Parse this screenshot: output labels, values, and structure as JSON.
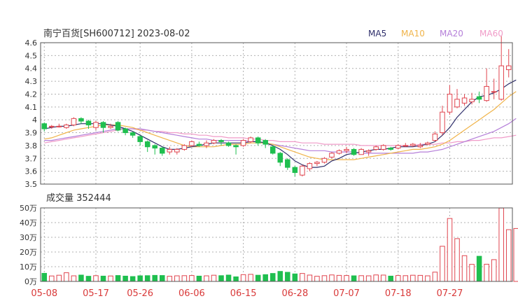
{
  "header": {
    "title": "南宁百货[SH600712] 2023-08-02",
    "legend": [
      {
        "label": "MA5",
        "color": "#2f2f6b"
      },
      {
        "label": "MA10",
        "color": "#f0b44a"
      },
      {
        "label": "MA20",
        "color": "#b57fd9"
      },
      {
        "label": "MA60",
        "color": "#f09bc8"
      }
    ]
  },
  "volume_panel": {
    "label": "成交量 352444"
  },
  "colors": {
    "up": "#e0454f",
    "down": "#1fbf4f",
    "grid": "#b0b0b0",
    "axis_text": "#333333",
    "x_text": "#d93a3a"
  },
  "chart_data": [
    {
      "type": "candlestick",
      "title": "南宁百货[SH600712] 2023-08-02",
      "ylim": [
        3.5,
        4.6
      ],
      "yticks": [
        "3.5",
        "3.6",
        "3.7",
        "3.8",
        "3.9",
        "4",
        "4.1",
        "4.2",
        "4.3",
        "4.4",
        "4.5",
        "4.6"
      ],
      "xticks": [
        {
          "index": 0,
          "label": "05-08"
        },
        {
          "index": 7,
          "label": "05-17"
        },
        {
          "index": 13,
          "label": "05-26"
        },
        {
          "index": 20,
          "label": "06-06"
        },
        {
          "index": 27,
          "label": "06-15"
        },
        {
          "index": 34,
          "label": "06-28"
        },
        {
          "index": 41,
          "label": "07-07"
        },
        {
          "index": 48,
          "label": "07-18"
        },
        {
          "index": 55,
          "label": "07-27"
        }
      ],
      "candles": [
        [
          3.97,
          3.93,
          3.98,
          3.91
        ],
        [
          3.95,
          3.95,
          3.96,
          3.93
        ],
        [
          3.95,
          3.95,
          3.97,
          3.94
        ],
        [
          3.94,
          3.96,
          3.97,
          3.93
        ],
        [
          3.96,
          4.01,
          4.02,
          3.95
        ],
        [
          4.01,
          3.99,
          4.02,
          3.97
        ],
        [
          3.99,
          3.96,
          4.0,
          3.93
        ],
        [
          3.94,
          3.98,
          3.99,
          3.92
        ],
        [
          3.98,
          3.94,
          3.99,
          3.9
        ],
        [
          3.94,
          3.95,
          3.97,
          3.93
        ],
        [
          3.98,
          3.92,
          3.99,
          3.91
        ],
        [
          3.93,
          3.9,
          3.94,
          3.88
        ],
        [
          3.9,
          3.88,
          3.91,
          3.86
        ],
        [
          3.87,
          3.83,
          3.88,
          3.8
        ],
        [
          3.83,
          3.79,
          3.84,
          3.75
        ],
        [
          3.8,
          3.78,
          3.81,
          3.73
        ],
        [
          3.78,
          3.74,
          3.79,
          3.72
        ],
        [
          3.75,
          3.77,
          3.79,
          3.73
        ],
        [
          3.75,
          3.77,
          3.78,
          3.73
        ],
        [
          3.77,
          3.8,
          3.81,
          3.76
        ],
        [
          3.8,
          3.83,
          3.84,
          3.79
        ],
        [
          3.81,
          3.8,
          3.83,
          3.79
        ],
        [
          3.8,
          3.82,
          3.84,
          3.78
        ],
        [
          3.82,
          3.84,
          3.85,
          3.81
        ],
        [
          3.84,
          3.83,
          3.85,
          3.8
        ],
        [
          3.82,
          3.8,
          3.83,
          3.79
        ],
        [
          3.8,
          3.79,
          3.81,
          3.73
        ],
        [
          3.8,
          3.84,
          3.85,
          3.79
        ],
        [
          3.83,
          3.86,
          3.87,
          3.82
        ],
        [
          3.86,
          3.82,
          3.87,
          3.8
        ],
        [
          3.84,
          3.81,
          3.85,
          3.78
        ],
        [
          3.79,
          3.74,
          3.8,
          3.73
        ],
        [
          3.74,
          3.67,
          3.75,
          3.64
        ],
        [
          3.69,
          3.63,
          3.7,
          3.61
        ],
        [
          3.63,
          3.59,
          3.64,
          3.56
        ],
        [
          3.57,
          3.64,
          3.65,
          3.56
        ],
        [
          3.62,
          3.66,
          3.67,
          3.6
        ],
        [
          3.66,
          3.67,
          3.68,
          3.64
        ],
        [
          3.67,
          3.7,
          3.71,
          3.66
        ],
        [
          3.71,
          3.74,
          3.75,
          3.7
        ],
        [
          3.74,
          3.76,
          3.77,
          3.73
        ],
        [
          3.76,
          3.77,
          3.79,
          3.74
        ],
        [
          3.77,
          3.73,
          3.78,
          3.72
        ],
        [
          3.73,
          3.77,
          3.78,
          3.73
        ],
        [
          3.75,
          3.76,
          3.77,
          3.72
        ],
        [
          3.77,
          3.79,
          3.8,
          3.76
        ],
        [
          3.77,
          3.8,
          3.81,
          3.76
        ],
        [
          3.78,
          3.77,
          3.79,
          3.76
        ],
        [
          3.78,
          3.8,
          3.81,
          3.77
        ],
        [
          3.8,
          3.8,
          3.82,
          3.79
        ],
        [
          3.8,
          3.81,
          3.82,
          3.79
        ],
        [
          3.79,
          3.8,
          3.82,
          3.78
        ],
        [
          3.81,
          3.82,
          3.83,
          3.8
        ],
        [
          3.84,
          3.89,
          3.91,
          3.83
        ],
        [
          3.9,
          4.06,
          4.11,
          3.88
        ],
        [
          4.06,
          4.2,
          4.27,
          4.04
        ],
        [
          4.1,
          4.16,
          4.24,
          4.09
        ],
        [
          4.13,
          4.17,
          4.2,
          4.11
        ],
        [
          4.14,
          4.16,
          4.21,
          4.12
        ],
        [
          4.18,
          4.16,
          4.22,
          4.13
        ],
        [
          4.15,
          4.26,
          4.4,
          4.14
        ],
        [
          4.22,
          4.22,
          4.32,
          4.16
        ],
        [
          4.16,
          4.42,
          4.65,
          4.15
        ],
        [
          4.39,
          4.42,
          4.55,
          4.33
        ]
      ],
      "ma": {
        "MA5": [
          3.93,
          3.94,
          3.95,
          3.95,
          3.96,
          3.97,
          3.97,
          3.97,
          3.97,
          3.96,
          3.95,
          3.93,
          3.91,
          3.88,
          3.85,
          3.82,
          3.79,
          3.77,
          3.77,
          3.78,
          3.79,
          3.8,
          3.81,
          3.82,
          3.82,
          3.82,
          3.82,
          3.82,
          3.83,
          3.83,
          3.82,
          3.8,
          3.77,
          3.73,
          3.68,
          3.65,
          3.63,
          3.63,
          3.64,
          3.68,
          3.7,
          3.73,
          3.74,
          3.75,
          3.76,
          3.77,
          3.77,
          3.78,
          3.79,
          3.79,
          3.79,
          3.8,
          3.81,
          3.83,
          3.88,
          3.94,
          4.02,
          4.08,
          4.14,
          4.18,
          4.19,
          4.21,
          4.24,
          4.28,
          4.31
        ],
        "MA10": [
          3.85,
          3.86,
          3.88,
          3.9,
          3.92,
          3.93,
          3.94,
          3.95,
          3.96,
          3.96,
          3.96,
          3.95,
          3.94,
          3.92,
          3.9,
          3.88,
          3.86,
          3.84,
          3.82,
          3.8,
          3.79,
          3.79,
          3.79,
          3.79,
          3.8,
          3.81,
          3.81,
          3.81,
          3.82,
          3.82,
          3.82,
          3.81,
          3.79,
          3.77,
          3.75,
          3.73,
          3.71,
          3.7,
          3.69,
          3.69,
          3.69,
          3.69,
          3.69,
          3.7,
          3.71,
          3.72,
          3.73,
          3.74,
          3.75,
          3.76,
          3.77,
          3.77,
          3.78,
          3.79,
          3.81,
          3.84,
          3.88,
          3.92,
          3.96,
          4.0,
          4.04,
          4.08,
          4.13,
          4.18,
          4.22
        ],
        "MA20": [
          3.84,
          3.84,
          3.85,
          3.86,
          3.87,
          3.88,
          3.89,
          3.9,
          3.91,
          3.92,
          3.93,
          3.93,
          3.93,
          3.93,
          3.92,
          3.91,
          3.9,
          3.89,
          3.88,
          3.87,
          3.86,
          3.85,
          3.85,
          3.84,
          3.84,
          3.84,
          3.84,
          3.84,
          3.83,
          3.83,
          3.82,
          3.81,
          3.8,
          3.79,
          3.78,
          3.77,
          3.76,
          3.76,
          3.76,
          3.75,
          3.75,
          3.75,
          3.75,
          3.74,
          3.74,
          3.74,
          3.74,
          3.74,
          3.74,
          3.74,
          3.74,
          3.75,
          3.75,
          3.76,
          3.77,
          3.79,
          3.81,
          3.83,
          3.85,
          3.87,
          3.89,
          3.91,
          3.94,
          3.97,
          4.01
        ],
        "MA60": [
          3.82,
          3.83,
          3.84,
          3.85,
          3.86,
          3.87,
          3.88,
          3.89,
          3.9,
          3.91,
          3.92,
          3.93,
          3.93,
          3.92,
          3.92,
          3.91,
          3.91,
          3.9,
          3.9,
          3.89,
          3.89,
          3.88,
          3.88,
          3.87,
          3.87,
          3.86,
          3.86,
          3.86,
          3.85,
          3.85,
          3.84,
          3.84,
          3.83,
          3.83,
          3.83,
          3.82,
          3.82,
          3.82,
          3.81,
          3.81,
          3.81,
          3.81,
          3.81,
          3.8,
          3.8,
          3.8,
          3.8,
          3.8,
          3.8,
          3.8,
          3.8,
          3.81,
          3.81,
          3.81,
          3.82,
          3.82,
          3.83,
          3.83,
          3.84,
          3.84,
          3.85,
          3.86,
          3.86,
          3.87,
          3.88
        ]
      }
    },
    {
      "type": "bar",
      "title": "成交量 352444",
      "ylim": [
        0,
        50
      ],
      "unit": "万",
      "yticks": [
        "0万",
        "10万",
        "20万",
        "30万",
        "40万",
        "50万"
      ],
      "values": [
        5.5,
        3.7,
        4.2,
        5.9,
        3.8,
        4.3,
        3.5,
        3.9,
        3.6,
        3.7,
        4.0,
        3.6,
        3.3,
        3.8,
        3.9,
        4.1,
        4.0,
        3.5,
        3.8,
        3.9,
        4.0,
        3.6,
        3.8,
        4.2,
        3.9,
        4.3,
        3.1,
        4.6,
        4.8,
        4.2,
        4.6,
        5.4,
        6.8,
        6.2,
        5.1,
        5.4,
        4.3,
        3.5,
        3.9,
        4.4,
        4.1,
        4.0,
        3.8,
        3.9,
        3.8,
        4.4,
        4.3,
        3.6,
        4.0,
        3.9,
        4.2,
        4.1,
        3.8,
        6.3,
        23.9,
        42.8,
        29.1,
        17.5,
        11.6,
        17.1,
        11.7,
        14.8,
        49.9,
        35.2,
        36.0
      ]
    }
  ]
}
